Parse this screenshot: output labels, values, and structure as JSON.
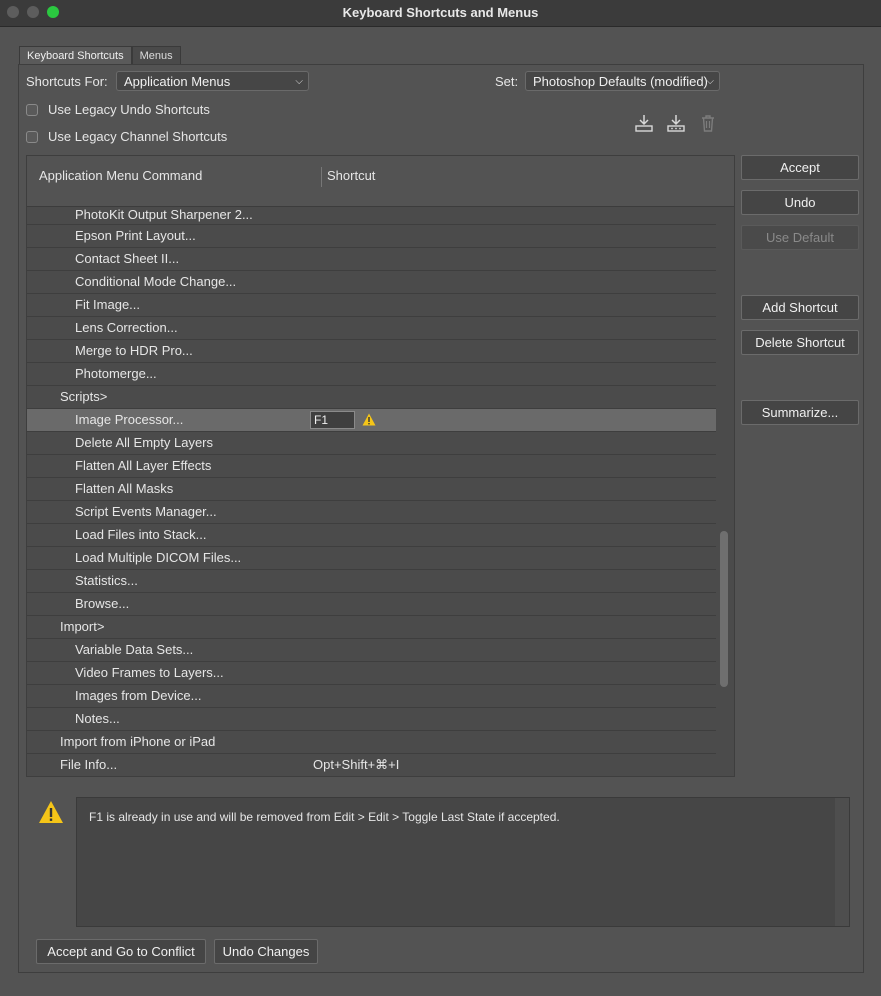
{
  "window": {
    "title": "Keyboard Shortcuts and Menus"
  },
  "tabs": [
    {
      "label": "Keyboard Shortcuts",
      "active": true
    },
    {
      "label": "Menus",
      "active": false
    }
  ],
  "controls": {
    "shortcuts_for_label": "Shortcuts For:",
    "shortcuts_for_value": "Application Menus",
    "set_label": "Set:",
    "set_value": "Photoshop Defaults (modified)",
    "legacy_undo_label": "Use Legacy Undo Shortcuts",
    "legacy_channel_label": "Use Legacy Channel Shortcuts",
    "legacy_undo_checked": false,
    "legacy_channel_checked": false
  },
  "icons": {
    "save_set": "save-set-icon",
    "save_set_as": "save-set-as-icon",
    "delete_set": "trash-icon"
  },
  "table": {
    "col_command": "Application Menu Command",
    "col_shortcut": "Shortcut",
    "rows": [
      {
        "command": "PhotoKit Output Sharpener 2...",
        "shortcut": "",
        "level": 2
      },
      {
        "command": "Epson Print Layout...",
        "shortcut": "",
        "level": 2
      },
      {
        "command": "Contact Sheet II...",
        "shortcut": "",
        "level": 2
      },
      {
        "command": "Conditional Mode Change...",
        "shortcut": "",
        "level": 2
      },
      {
        "command": "Fit Image...",
        "shortcut": "",
        "level": 2
      },
      {
        "command": "Lens Correction...",
        "shortcut": "",
        "level": 2
      },
      {
        "command": "Merge to HDR Pro...",
        "shortcut": "",
        "level": 2
      },
      {
        "command": "Photomerge...",
        "shortcut": "",
        "level": 2
      },
      {
        "command": "Scripts>",
        "shortcut": "",
        "level": 1
      },
      {
        "command": "Image Processor...",
        "shortcut": "F1",
        "level": 2,
        "selected": true,
        "editing": true,
        "warning": true
      },
      {
        "command": "Delete All Empty Layers",
        "shortcut": "",
        "level": 2
      },
      {
        "command": "Flatten All Layer Effects",
        "shortcut": "",
        "level": 2
      },
      {
        "command": "Flatten All Masks",
        "shortcut": "",
        "level": 2
      },
      {
        "command": "Script Events Manager...",
        "shortcut": "",
        "level": 2
      },
      {
        "command": "Load Files into Stack...",
        "shortcut": "",
        "level": 2
      },
      {
        "command": "Load Multiple DICOM Files...",
        "shortcut": "",
        "level": 2
      },
      {
        "command": "Statistics...",
        "shortcut": "",
        "level": 2
      },
      {
        "command": "Browse...",
        "shortcut": "",
        "level": 2
      },
      {
        "command": "Import>",
        "shortcut": "",
        "level": 1
      },
      {
        "command": "Variable Data Sets...",
        "shortcut": "",
        "level": 2
      },
      {
        "command": "Video Frames to Layers...",
        "shortcut": "",
        "level": 2
      },
      {
        "command": "Images from Device...",
        "shortcut": "",
        "level": 2
      },
      {
        "command": "Notes...",
        "shortcut": "",
        "level": 2
      },
      {
        "command": "Import from iPhone or iPad",
        "shortcut": "",
        "level": 1
      },
      {
        "command": "File Info...",
        "shortcut": "Opt+Shift+⌘+I",
        "level": 1
      }
    ]
  },
  "buttons": {
    "accept": "Accept",
    "undo": "Undo",
    "use_default": "Use Default",
    "add_shortcut": "Add Shortcut",
    "delete_shortcut": "Delete Shortcut",
    "summarize": "Summarize...",
    "accept_go_conflict": "Accept and Go to Conflict",
    "undo_changes": "Undo Changes"
  },
  "message": {
    "text": "F1 is already in use and will be removed from Edit > Edit > Toggle Last State if accepted."
  },
  "colors": {
    "background": "#535353",
    "warning": "#f5c518",
    "maximize": "#2bc840"
  }
}
